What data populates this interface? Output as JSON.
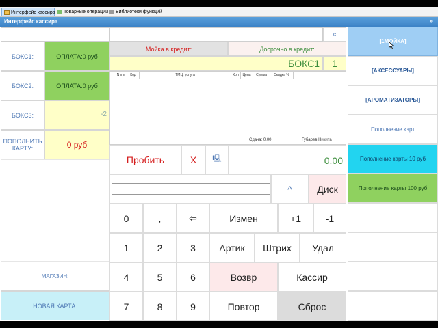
{
  "tabs": [
    {
      "label": "Интерфейс кассира"
    },
    {
      "label": "Товарные операции"
    },
    {
      "label": "Библиотеки функций"
    }
  ],
  "window": {
    "title": "Интерфейс кассира",
    "close": "»"
  },
  "collapse": "«",
  "boxes": [
    {
      "label": "БОКС1:",
      "value": "ОПЛАТА:0 руб"
    },
    {
      "label": "БОКС2:",
      "value": "ОПЛАТА:0 руб"
    },
    {
      "label": "БОКС3:",
      "value": "-2"
    },
    {
      "label": "ПОПОЛНИТЬ КАРТУ:",
      "value": "0 руб"
    }
  ],
  "credit": {
    "wash": "Мойка в кредит:",
    "early": "Досрочно в кредит:"
  },
  "selected_box": {
    "name": "БОКС1",
    "number": "1"
  },
  "table_headers": [
    "N п п",
    "Код",
    "ТМЦ, услуга",
    "Кол",
    "Цена",
    "Сумма",
    "Скидка %"
  ],
  "footer": {
    "change": "Сдача: 0.00",
    "cashier": "Губарев Никита"
  },
  "actions": {
    "print": "Пробить",
    "cancel": "Х",
    "screen": "🖳",
    "total": "0.00"
  },
  "search": {
    "value": "",
    "up": "^",
    "disk": "Диск"
  },
  "keypad": {
    "row1": [
      "0",
      ",",
      "⇦",
      "Измен",
      "+1",
      "-1"
    ],
    "row2": [
      "1",
      "2",
      "3",
      "Артик",
      "Штрих",
      "Удал"
    ],
    "row3": [
      "4",
      "5",
      "6",
      "Возвр",
      "Кассир"
    ],
    "row4": [
      "7",
      "8",
      "9",
      "Повтор",
      "Сброс"
    ]
  },
  "left_bottom": {
    "shop": "МАГАЗИН:",
    "new_card": "НОВАЯ КАРТА:"
  },
  "categories": [
    {
      "label": "[1МОЙКА]"
    },
    {
      "label": "[АКСЕССУАРЫ]"
    },
    {
      "label": "[АРОМАТИЗАТОРЫ]"
    },
    {
      "label": "Пополнение карт"
    },
    {
      "label": "Пополнение карты 10 руб"
    },
    {
      "label": "Пополнение карты 100 руб"
    }
  ],
  "colors": {
    "accent": "#4f79b5",
    "green": "#8fd15f",
    "cyan": "#22d4f0",
    "red": "#d51f1f"
  }
}
